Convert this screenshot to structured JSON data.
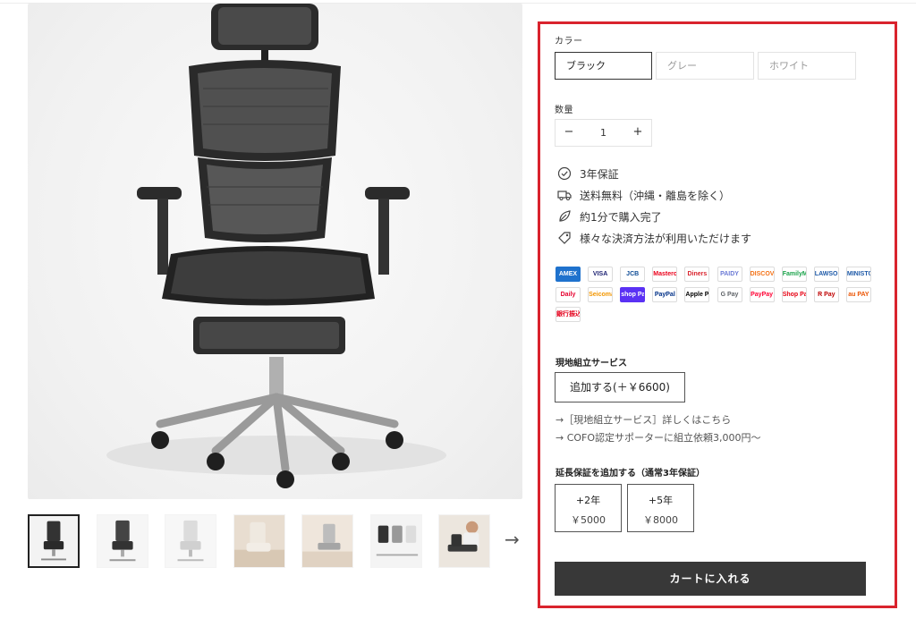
{
  "gallery": {
    "thumbnail_count": 7,
    "active_thumbnail": 1,
    "next_arrow": "→"
  },
  "options": {
    "color_label": "カラー",
    "colors": [
      "ブラック",
      "グレー",
      "ホワイト"
    ],
    "selected_color": "ブラック",
    "quantity_label": "数量",
    "quantity_value": "1",
    "minus": "−",
    "plus": "+"
  },
  "features": [
    {
      "icon": "check-circle-icon",
      "text": "3年保証"
    },
    {
      "icon": "truck-icon",
      "text": "送料無料（沖縄・離島を除く）"
    },
    {
      "icon": "leaf-icon",
      "text": "約1分で購入完了"
    },
    {
      "icon": "tag-icon",
      "text": "様々な決済方法が利用いただけます"
    }
  ],
  "payment_methods": [
    {
      "name": "AMEX",
      "color": "#1f72cd",
      "fill": true
    },
    {
      "name": "VISA",
      "color": "#1a1f71",
      "fill": false
    },
    {
      "name": "JCB",
      "color": "#0e4c96",
      "fill": false
    },
    {
      "name": "Mastercard",
      "color": "#eb001b",
      "fill": false
    },
    {
      "name": "Diners",
      "color": "#d9232d",
      "fill": false
    },
    {
      "name": "PAIDY",
      "color": "#6c7bd6",
      "fill": false
    },
    {
      "name": "DISCOVER",
      "color": "#f47216",
      "fill": false
    },
    {
      "name": "FamilyMart",
      "color": "#1aa34a",
      "fill": false
    },
    {
      "name": "LAWSON",
      "color": "#1e5aa8",
      "fill": false
    },
    {
      "name": "MINISTOP",
      "color": "#1e5aa8",
      "fill": false
    },
    {
      "name": "Daily",
      "color": "#e6002e",
      "fill": false
    },
    {
      "name": "Seicomart",
      "color": "#f29600",
      "fill": false
    },
    {
      "name": "shop Pay",
      "color": "#5a31f4",
      "fill": true
    },
    {
      "name": "PayPal",
      "color": "#003087",
      "fill": false
    },
    {
      "name": "Apple Pay",
      "color": "#000000",
      "fill": false
    },
    {
      "name": "G Pay",
      "color": "#5f6368",
      "fill": false
    },
    {
      "name": "PayPay",
      "color": "#ff0033",
      "fill": false
    },
    {
      "name": "Shop Pay",
      "color": "#e60012",
      "fill": false
    },
    {
      "name": "R Pay",
      "color": "#bf0000",
      "fill": false
    },
    {
      "name": "au PAY",
      "color": "#eb5505",
      "fill": false
    },
    {
      "name": "銀行振込",
      "color": "#e4001b",
      "fill": false
    }
  ],
  "assembly": {
    "title": "現地組立サービス",
    "button": "追加する(＋￥6600)",
    "link1": "→［現地組立サービス］詳しくはこちら",
    "link2": "→ COFO認定サポーターに組立依頼3,000円〜"
  },
  "warranty": {
    "title": "延長保証を追加する（通常3年保証）",
    "options": [
      {
        "label": "+2年",
        "price": "￥5000"
      },
      {
        "label": "+5年",
        "price": "￥8000"
      }
    ]
  },
  "cart_button": "カートに入れる",
  "colors": {
    "highlight_border": "#d9232d",
    "cart_bg": "#383838"
  }
}
